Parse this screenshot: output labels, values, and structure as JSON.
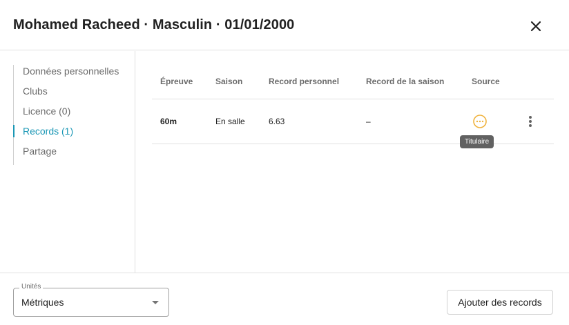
{
  "dialog": {
    "title": "Mohamed Racheed · Masculin · 01/01/2000",
    "close_icon": "close-icon"
  },
  "sidebar": {
    "items": [
      {
        "label": "Données personnelles",
        "active": false
      },
      {
        "label": "Clubs",
        "active": false
      },
      {
        "label": "Licence (0)",
        "active": false
      },
      {
        "label": "Records (1)",
        "active": true
      },
      {
        "label": "Partage",
        "active": false
      }
    ]
  },
  "table": {
    "columns": [
      "Épreuve",
      "Saison",
      "Record personnel",
      "Record de la saison",
      "Source"
    ],
    "rows": [
      {
        "epreuve": "60m",
        "saison": "En salle",
        "record_personnel": "6.63",
        "record_saison": "–",
        "source_icon": "more-horizontal-circle-icon",
        "source_tooltip": "Titulaire",
        "actions_icon": "more-vertical-icon"
      }
    ]
  },
  "footer": {
    "units_label": "Unités",
    "units_value": "Métriques",
    "add_button": "Ajouter des records"
  },
  "colors": {
    "accent": "#1a97b5",
    "source_icon": "#f0b23c",
    "tooltip_bg": "#616161"
  }
}
